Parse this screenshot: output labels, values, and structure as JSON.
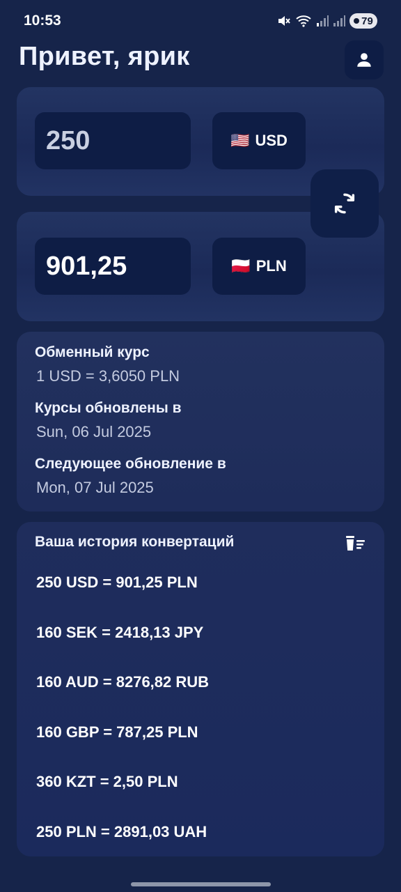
{
  "status_bar": {
    "time": "10:53",
    "battery_level": "79",
    "icons": [
      "mute-icon",
      "wifi-icon",
      "signal-icon",
      "signal-icon"
    ]
  },
  "header": {
    "greeting": "Привет, ярик",
    "profile_icon": "person-icon"
  },
  "converter": {
    "from": {
      "amount": "250",
      "flag": "🇺🇸",
      "currency": "USD"
    },
    "to": {
      "amount": "901,25",
      "flag": "🇵🇱",
      "currency": "PLN"
    },
    "swap_icon": "swap-icon"
  },
  "rates": {
    "exchange_rate_label": "Обменный курс",
    "exchange_rate_value": "1 USD = 3,6050 PLN",
    "updated_label": "Курсы обновлены в",
    "updated_value": "Sun, 06 Jul 2025",
    "next_update_label": "Следующее обновление в",
    "next_update_value": "Mon, 07 Jul 2025"
  },
  "history": {
    "title": "Ваша история конвертаций",
    "clear_icon": "delete-sweep-icon",
    "items": [
      "250 USD = 901,25 PLN",
      "160 SEK = 2418,13 JPY",
      "160 AUD = 8276,82 RUB",
      "160 GBP = 787,25 PLN",
      "360 KZT = 2,50 PLN",
      "250 PLN = 2891,03 UAH"
    ]
  },
  "colors": {
    "background": "#16244a",
    "card": "#1e2d5c",
    "input": "#0e1d45",
    "text": "#ffffff",
    "muted_text": "#c4cbe0"
  }
}
